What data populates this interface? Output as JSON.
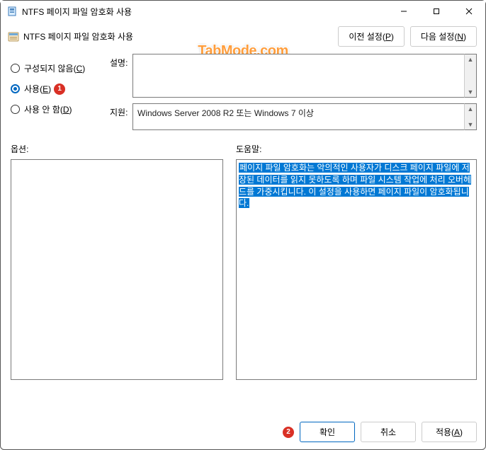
{
  "titlebar": {
    "title": "NTFS 페이지 파일 암호화 사용"
  },
  "header": {
    "title": "NTFS 페이지 파일 암호화 사용",
    "prev_setting": "이전 설정",
    "prev_key": "P",
    "next_setting": "다음 설정",
    "next_key": "N"
  },
  "radios": {
    "not_configured": "구성되지 않음",
    "not_configured_key": "C",
    "enabled": "사용",
    "enabled_key": "E",
    "disabled": "사용 안 함",
    "disabled_key": "D"
  },
  "fields": {
    "description_label": "설명:",
    "support_label": "지원:",
    "support_value": "Windows Server 2008 R2 또는 Windows 7 이상"
  },
  "panels": {
    "options_label": "옵션:",
    "help_label": "도움말:",
    "help_text": "페이지 파일 암호화는 악의적인 사용자가 디스크 페이지 파일에 저장된 데이터를 읽지 못하도록 하며 파일 시스템 작업에 처리 오버헤드를 가중시킵니다.  이 설정을 사용하면 페이지 파일이 암호화됩니다."
  },
  "footer": {
    "ok": "확인",
    "cancel": "취소",
    "apply": "적용",
    "apply_key": "A"
  },
  "markers": {
    "one": "1",
    "two": "2"
  },
  "watermark": "TabMode.com"
}
